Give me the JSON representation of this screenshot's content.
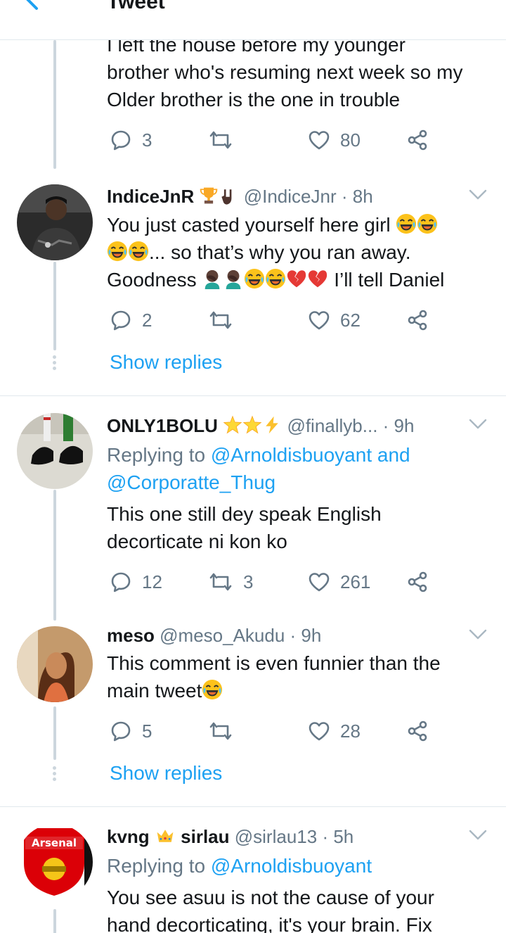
{
  "header": {
    "title": "Tweet"
  },
  "tweets": [
    {
      "text_lines": [
        "I left the house before my younger",
        "brother who's resuming next week so my",
        "Older brother is the one in trouble"
      ],
      "replies": "3",
      "retweets": "",
      "likes": "80"
    },
    {
      "name": "IndiceJnR",
      "handle": "@IndiceJnr",
      "time": "· 8h",
      "text_line1": "You just casted yourself here girl",
      "text_line2": "... so that’s why you ran away.",
      "text_line3a": "Goodness",
      "text_line3b": "I’ll tell Daniel",
      "replies": "2",
      "retweets": "",
      "likes": "62",
      "show_replies": "Show replies"
    },
    {
      "name": "ONLY1BOLU",
      "handle": "@finallyb...",
      "time": "· 9h",
      "replying_prefix": "Replying to",
      "replying_user1": "@Arnoldisbuoyant and",
      "replying_user2": "@Corporatte_Thug",
      "text_lines": [
        "This one still dey speak English",
        "decorticate ni kon ko"
      ],
      "replies": "12",
      "retweets": "3",
      "likes": "261"
    },
    {
      "name": "meso",
      "handle": "@meso_Akudu",
      "time": "· 9h",
      "text_line1": "This comment is even funnier than the",
      "text_line2": "main tweet",
      "replies": "5",
      "retweets": "",
      "likes": "28",
      "show_replies": "Show replies"
    },
    {
      "name_part1": "kvng",
      "name_part2": "sirlau",
      "handle": "@sirlau13",
      "time": "· 5h",
      "replying_prefix": "Replying to",
      "replying_user1": "@Arnoldisbuoyant",
      "text_lines": [
        "You see asuu is not the cause of your",
        "hand decorticating, it's your brain. Fix"
      ],
      "avatar_badge": "Arsenal"
    }
  ],
  "colors": {
    "link": "#1da1f2",
    "muted": "#657786",
    "text": "#14171a",
    "thread": "#ccd6dd"
  }
}
